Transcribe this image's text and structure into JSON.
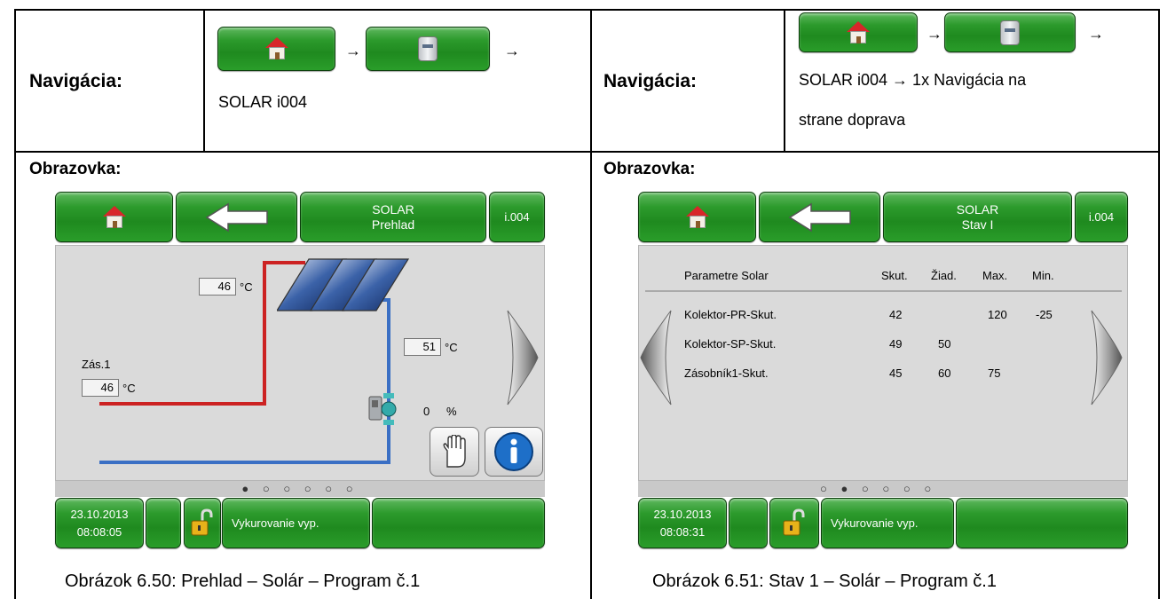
{
  "left": {
    "nav_label": "Navigácia:",
    "nav_arrow1": "→",
    "nav_arrow2": "→",
    "nav_path": "SOLAR i004",
    "screen_label": "Obrazovka:",
    "screen": {
      "header": {
        "title_line1": "SOLAR",
        "title_line2": "Prehlad",
        "code": "i.004"
      },
      "collector_temp": "46",
      "collector_temp_unit": "°C",
      "return_temp": "51",
      "return_temp_unit": "°C",
      "tank_label": "Zás.1",
      "tank_temp": "46",
      "tank_temp_unit": "°C",
      "pump_value": "0",
      "pump_unit": "%",
      "page_dots": "● ○ ○ ○ ○ ○",
      "footer": {
        "date": "23.10.2013",
        "time": "08:08:05",
        "status": "Vykurovanie vyp."
      }
    },
    "caption": "Obrázok 6.50: Prehlad – Solár – Program č.1"
  },
  "right": {
    "nav_label": "Navigácia:",
    "nav_arrow1": "→",
    "nav_arrow2": "→",
    "nav_line2": "SOLAR i004 → 1x Navigácia na",
    "nav_line3": "strane doprava",
    "screen_label": "Obrazovka:",
    "screen": {
      "header": {
        "title_line1": "SOLAR",
        "title_line2": "Stav I",
        "code": "i.004"
      },
      "table": {
        "headers": [
          "Parametre Solar",
          "Skut.",
          "Žiad.",
          "Max.",
          "Min."
        ],
        "rows": [
          [
            "Kolektor-PR-Skut.",
            "42",
            "",
            "120",
            "-25"
          ],
          [
            "Kolektor-SP-Skut.",
            "49",
            "50",
            "",
            ""
          ],
          [
            "Zásobník1-Skut.",
            "45",
            "60",
            "75",
            ""
          ]
        ]
      },
      "page_dots": "○ ● ○ ○ ○ ○",
      "footer": {
        "date": "23.10.2013",
        "time": "08:08:31",
        "status": "Vykurovanie vyp."
      }
    },
    "caption": "Obrázok 6.51: Stav 1 – Solár – Program č.1"
  }
}
